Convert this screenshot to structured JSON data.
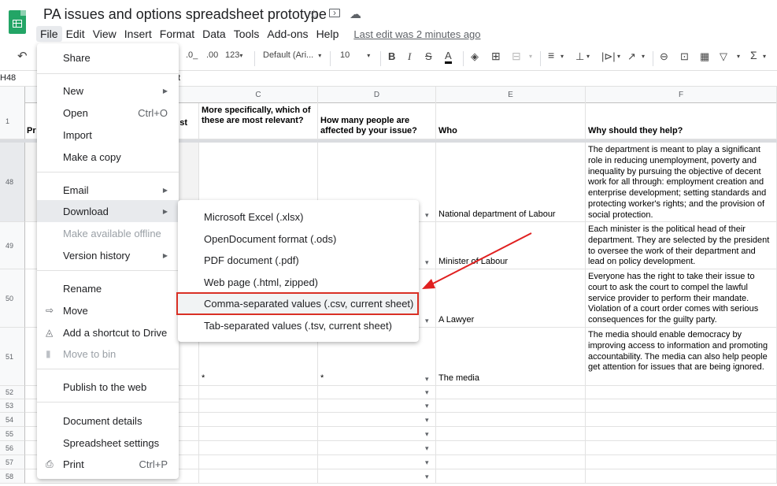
{
  "app": {
    "title": "PA issues and options spreadsheet prototype",
    "icons": [
      "star-icon",
      "move-to-folder-icon",
      "cloud-status-icon"
    ]
  },
  "menubar": {
    "items": [
      "File",
      "Edit",
      "View",
      "Insert",
      "Format",
      "Data",
      "Tools",
      "Add-ons",
      "Help"
    ],
    "last_edit": "Last edit was 2 minutes ago"
  },
  "toolbar": {
    "zoom_fmt1": ".0_",
    "zoom_fmt2": ".00",
    "number_format": "123",
    "font": "Default (Ari...",
    "font_size": "10"
  },
  "formula_bar": {
    "cell_ref": "H48",
    "content": "t"
  },
  "columns": [
    "C",
    "D",
    "E",
    "F"
  ],
  "header_row": {
    "row_num": "1",
    "colB_partial": "st",
    "colA_partial": "Pr",
    "C": "More specifically, which of these are most relevant?",
    "D": "How many people are affected by your issue?",
    "E": "Who",
    "F": "Why should they help?"
  },
  "rows": [
    {
      "num": "48",
      "who": "National department of Labour",
      "why": "The department is meant to play a significant role in reducing unemployment, poverty and inequality by pursuing the objective of decent work for all through: employment creation and enterprise development; setting standards and protecting worker's rights; and the provision of social protection."
    },
    {
      "num": "49",
      "who": "Minister of Labour",
      "why": "Each minister is the political head of their department. They are selected by the president to oversee the work of their department and lead on policy development."
    },
    {
      "num": "50",
      "who": "A Lawyer",
      "why": "Everyone has the right to take their issue to court to ask the court to compel the lawful service provider to perform their mandate. Violation of a court order comes with serious consequences for the guilty party."
    },
    {
      "num": "51",
      "who": "The media",
      "why": "The media should enable democracy by improving access to information and promoting accountability. The media can also help people get attention for issues that are being ignored.",
      "c": "*",
      "d": "*"
    }
  ],
  "empty_rows": [
    "52",
    "53",
    "54",
    "55",
    "56",
    "57",
    "58"
  ],
  "partial_cell_58": "58",
  "file_menu": {
    "items": [
      {
        "label": "Share"
      },
      {
        "label": "New",
        "submenu": true
      },
      {
        "label": "Open",
        "shortcut": "Ctrl+O"
      },
      {
        "label": "Import"
      },
      {
        "label": "Make a copy"
      },
      {
        "label": "Email",
        "submenu": true
      },
      {
        "label": "Download",
        "submenu": true,
        "active": true
      },
      {
        "label": "Make available offline",
        "disabled": true
      },
      {
        "label": "Version history",
        "submenu": true
      },
      {
        "label": "Rename"
      },
      {
        "label": "Move",
        "icon": "move-icon"
      },
      {
        "label": "Add a shortcut to Drive",
        "icon": "drive-shortcut-icon"
      },
      {
        "label": "Move to bin",
        "icon": "bin-icon",
        "disabled": true
      },
      {
        "label": "Publish to the web"
      },
      {
        "label": "Document details"
      },
      {
        "label": "Spreadsheet settings"
      },
      {
        "label": "Print",
        "shortcut": "Ctrl+P",
        "icon": "print-icon"
      }
    ]
  },
  "download_menu": {
    "items": [
      "Microsoft Excel (.xlsx)",
      "OpenDocument format (.ods)",
      "PDF document (.pdf)",
      "Web page (.html, zipped)",
      "Comma-separated values (.csv, current sheet)",
      "Tab-separated values (.tsv, current sheet)"
    ],
    "highlighted_index": 4
  },
  "colors": {
    "accent": "#23a566",
    "annotation": "#d93025"
  }
}
